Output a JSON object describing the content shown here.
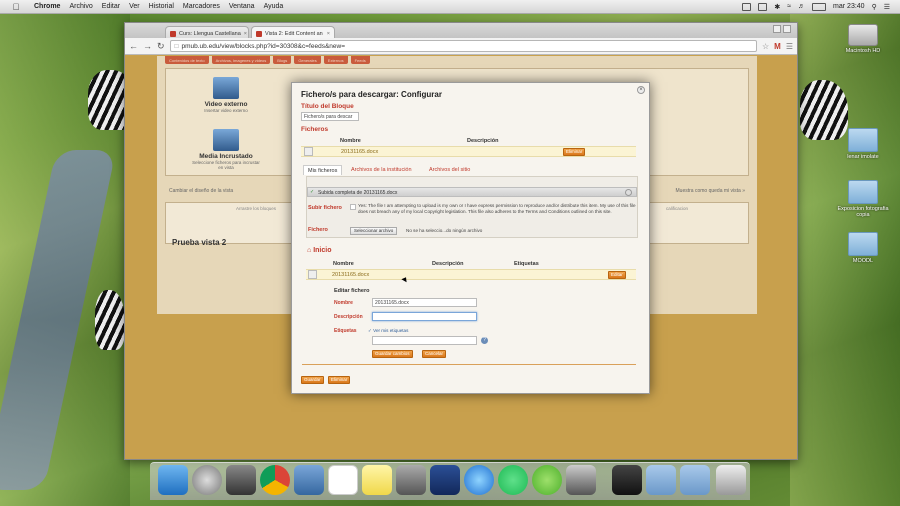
{
  "menubar": {
    "app_name": "Chrome",
    "items": [
      "Archivo",
      "Editar",
      "Ver",
      "Historial",
      "Marcadores",
      "Ventana",
      "Ayuda"
    ],
    "clock": "mar 23:40"
  },
  "desktop_icons": [
    "Macintosh HD",
    "lenar imolate",
    "Exposicion fotografia copia",
    "MOODL"
  ],
  "browser": {
    "tabs": [
      "Curs: Llengua Castellana",
      "Vista 2: Edit Content an"
    ],
    "url": "pmub.ub.edu/view/blocks.php?id=30308&c=feeds&new="
  },
  "background_page": {
    "tabs": [
      "Contenidos de texto",
      "Archivos, imagenes y videos",
      "Blogs",
      "Generales",
      "Externos",
      "Feeds"
    ],
    "blocks": [
      {
        "title": "Video externo",
        "desc": "Insertar video externo"
      },
      {
        "title": "Media Incrustado",
        "desc": "Seleccione ficheros para incrustar en vista"
      }
    ],
    "change_design": "Cambiar el diseño de la vista",
    "show_how": "Muestra como queda mi vista »",
    "drag_hint": "Arrastre los bloques",
    "calification": "calificacion",
    "view_title": "Prueba vista 2"
  },
  "modal": {
    "title": "Fichero/s para descargar: Configurar",
    "block_title_label": "Título del Bloque",
    "block_title_value": "Fichero/s para descar",
    "files_label": "Ficheros",
    "col_nombre": "Nombre",
    "col_descripcion": "Descripción",
    "col_etiquetas": "Etiquetas",
    "attached_file": "20131165.docx",
    "remove_button": "Eliminar",
    "subtabs": [
      "Mis ficheros",
      "Archivos de la institución",
      "Archivos del sitio"
    ],
    "upload_success": "Subida completa de 20131165.docx",
    "upload_label": "Subir fichero",
    "consent_text": "Yes: The file I am attempting to upload is my own or I have express permission to reproduce and/or distribute this item. My use of this file does not breach any of my local Copyright legislation. This file also adheres to the Terms and Conditions outlined on this site.",
    "file_label": "Fichero",
    "choose_file_button": "Seleccionar archivo",
    "no_file_text": "No se ha seleccio...do ningún archivo",
    "home_label": "Inicio",
    "list_file": "20131165.docx",
    "edit_button": "Editar",
    "edit_heading": "Editar fichero",
    "edit_name_label": "Nombre",
    "edit_name_value": "20131165.docx",
    "edit_desc_label": "Descripción",
    "edit_tags_label": "Etiquetas",
    "my_tags": "Ver mis etiquetas",
    "save_changes": "Guardar cambios",
    "cancel": "Cancelar",
    "save": "Guardar",
    "delete": "Eliminar"
  }
}
